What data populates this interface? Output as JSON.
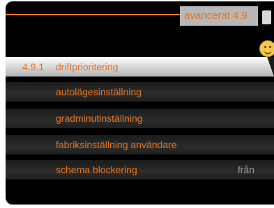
{
  "header": {
    "title": "avancerat 4.9"
  },
  "menu": {
    "items": [
      {
        "num": "4.9.1",
        "label": "driftprioritering",
        "value": "",
        "selected": true
      },
      {
        "num": "",
        "label": "autolägesinställning",
        "value": "",
        "selected": false
      },
      {
        "num": "",
        "label": "gradminutinställning",
        "value": "",
        "selected": false
      },
      {
        "num": "",
        "label": "fabriksinställning användare",
        "value": "",
        "selected": false
      },
      {
        "num": "",
        "label": "schema blockering",
        "value": "från",
        "selected": false
      }
    ]
  },
  "colors": {
    "accent": "#e8741f",
    "background": "#000000",
    "selected_row": "#d0d0d0",
    "value_text": "#9a9a9a"
  },
  "icons": {
    "scroll": "scrollbar-thumb-icon",
    "status": "smiley-icon"
  }
}
